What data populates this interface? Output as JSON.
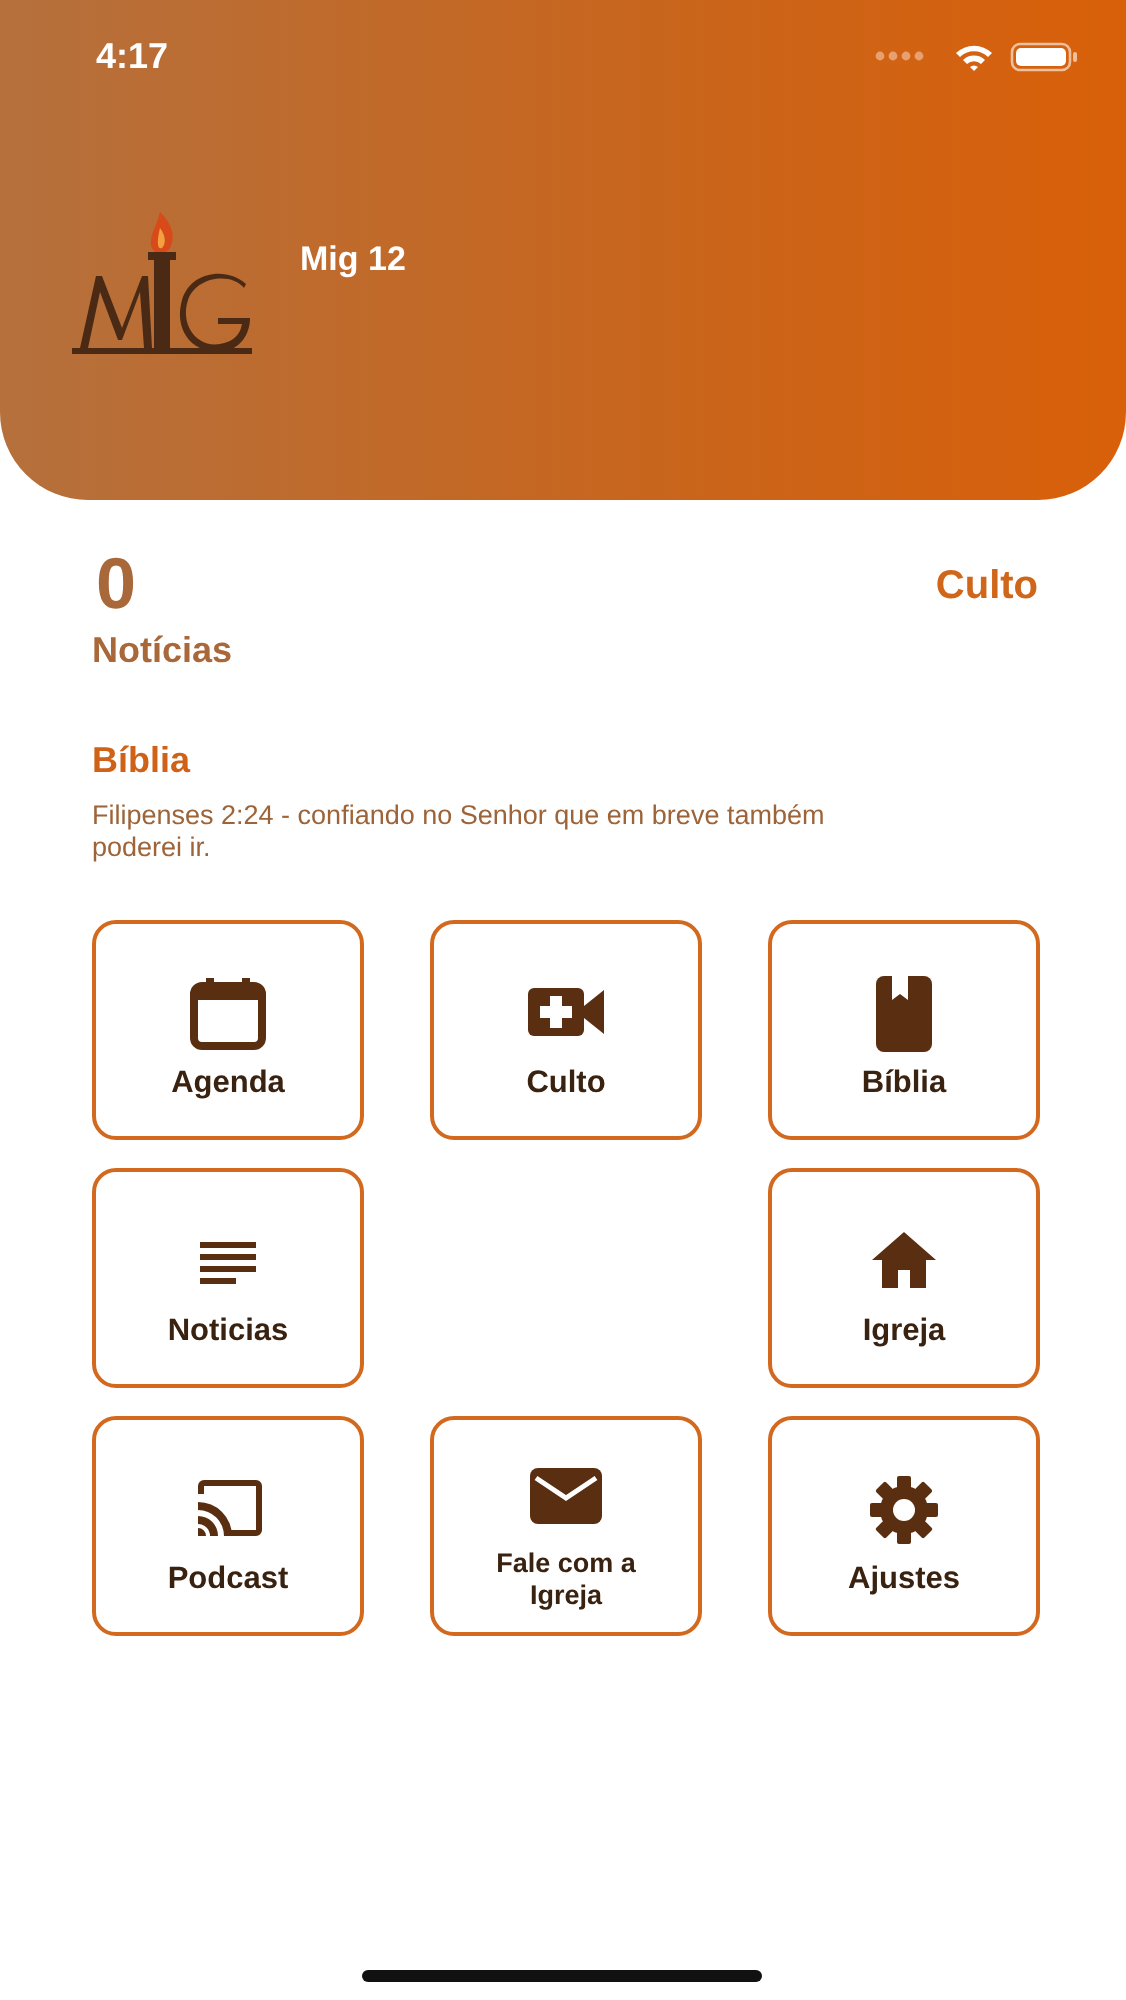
{
  "status_bar": {
    "time": "4:17"
  },
  "header": {
    "title": "Mig 12"
  },
  "summary": {
    "count": "0",
    "count_label": "Notícias",
    "link": "Culto"
  },
  "verse": {
    "heading": "Bíblia",
    "text": "Filipenses 2:24 - confiando no Senhor que em breve também poderei ir."
  },
  "tiles": [
    {
      "kind": "tile",
      "label": "Agenda"
    },
    {
      "kind": "tile",
      "label": "Culto"
    },
    {
      "kind": "tile",
      "label": "Bíblia"
    },
    {
      "kind": "tile",
      "label": "Noticias"
    },
    {
      "kind": "empty"
    },
    {
      "kind": "tile",
      "label": "Igreja"
    },
    {
      "kind": "tile",
      "label": "Podcast"
    },
    {
      "kind": "tile",
      "label": "Fale com a Igreja",
      "small": true
    },
    {
      "kind": "tile",
      "label": "Ajustes"
    }
  ]
}
